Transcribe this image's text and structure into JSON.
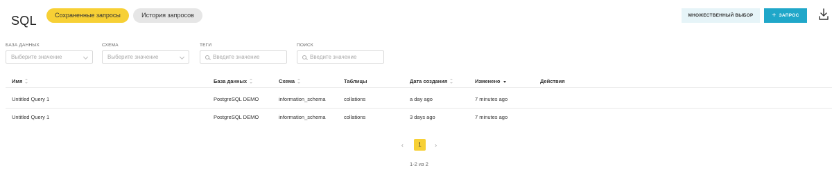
{
  "header": {
    "title": "SQL",
    "tabs": [
      {
        "label": "Сохраненные запросы",
        "active": true
      },
      {
        "label": "История запросов",
        "active": false
      }
    ],
    "multi_select_label": "МНОЖЕСТВЕННЫЙ ВЫБОР",
    "query_button_label": "ЗАПРОС",
    "query_button_icon": "plus-icon",
    "download_icon": "download-icon"
  },
  "filters": {
    "database": {
      "label": "БАЗА ДАННЫХ",
      "placeholder": "Выберите значение"
    },
    "schema": {
      "label": "СХЕМА",
      "placeholder": "Выберите значение"
    },
    "tags": {
      "label": "ТЕГИ",
      "placeholder": "Введите значение"
    },
    "search": {
      "label": "ПОИСК",
      "placeholder": "Введите значение"
    }
  },
  "table": {
    "columns": {
      "name": "Имя",
      "database": "База данных",
      "schema": "Схема",
      "tables": "Таблицы",
      "created": "Дата создания",
      "modified": "Изменено",
      "actions": "Действия"
    },
    "rows": [
      {
        "name": "Untitled Query 1",
        "database": "PostgreSQL DEMO",
        "schema": "information_schema",
        "tables": "collations",
        "created": "a day ago",
        "modified": "7 minutes ago"
      },
      {
        "name": "Untitled Query 1",
        "database": "PostgreSQL DEMO",
        "schema": "information_schema",
        "tables": "collations",
        "created": "3 days ago",
        "modified": "7 minutes ago"
      }
    ]
  },
  "pagination": {
    "prev": "‹",
    "current": "1",
    "next": "›",
    "summary": "1-2 из 2"
  },
  "colors": {
    "accent_yellow": "#f7d035",
    "accent_blue": "#20a7c9",
    "multi_select_bg": "#e6f4f8"
  }
}
